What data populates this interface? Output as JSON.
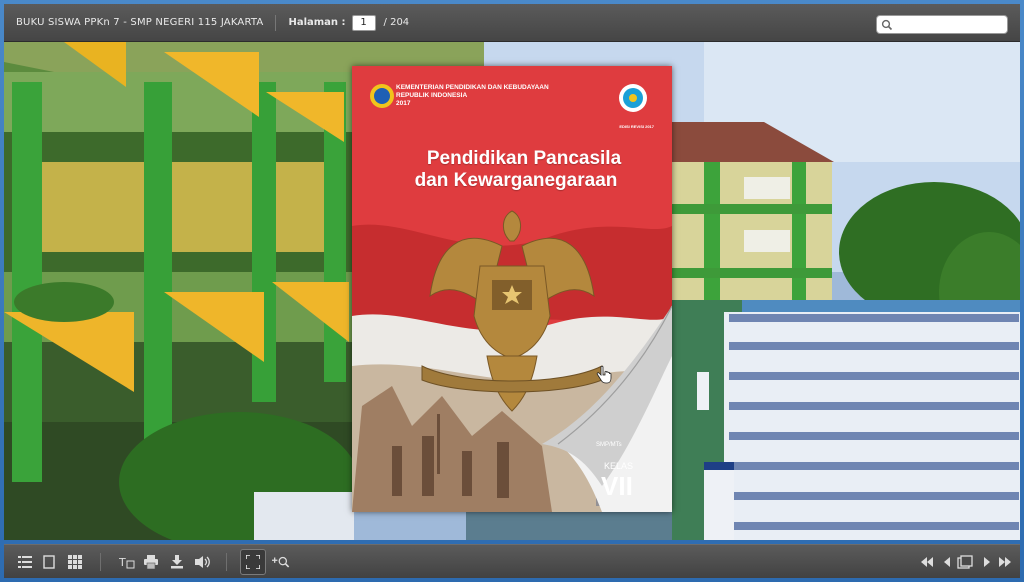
{
  "header": {
    "book_title": "BUKU SISWA PPKn 7 - SMP NEGERI 115 JAKARTA",
    "page_label": "Halaman :",
    "current_page": "1",
    "page_total": "/ 204",
    "search_placeholder": ""
  },
  "book_cover": {
    "publisher": [
      "KEMENTERIAN PENDIDIKAN DAN KEBUDAYAAN",
      "REPUBLIK INDONESIA",
      "2017"
    ],
    "edition_label": "EDISI REVISI 2017",
    "title_lines": [
      "Pendidikan Pancasila",
      "dan Kewarganegaraan"
    ],
    "level": "SMP/MTs",
    "class_label": "KELAS",
    "class_value": "VII"
  },
  "toolbar": {
    "left_buttons": [
      "table-of-contents-icon",
      "single-page-icon",
      "thumbnails-icon",
      "text-select-icon",
      "print-icon",
      "download-icon",
      "sound-icon",
      "fullscreen-icon",
      "zoom-in-icon"
    ],
    "right_buttons": [
      "first-page-icon",
      "previous-page-icon",
      "goto-page-icon",
      "next-page-icon",
      "last-page-icon"
    ]
  },
  "colors": {
    "bar": "#4f4f4f",
    "cover_red": "#df3c3f",
    "frame_blue": "#3f7fc2"
  }
}
